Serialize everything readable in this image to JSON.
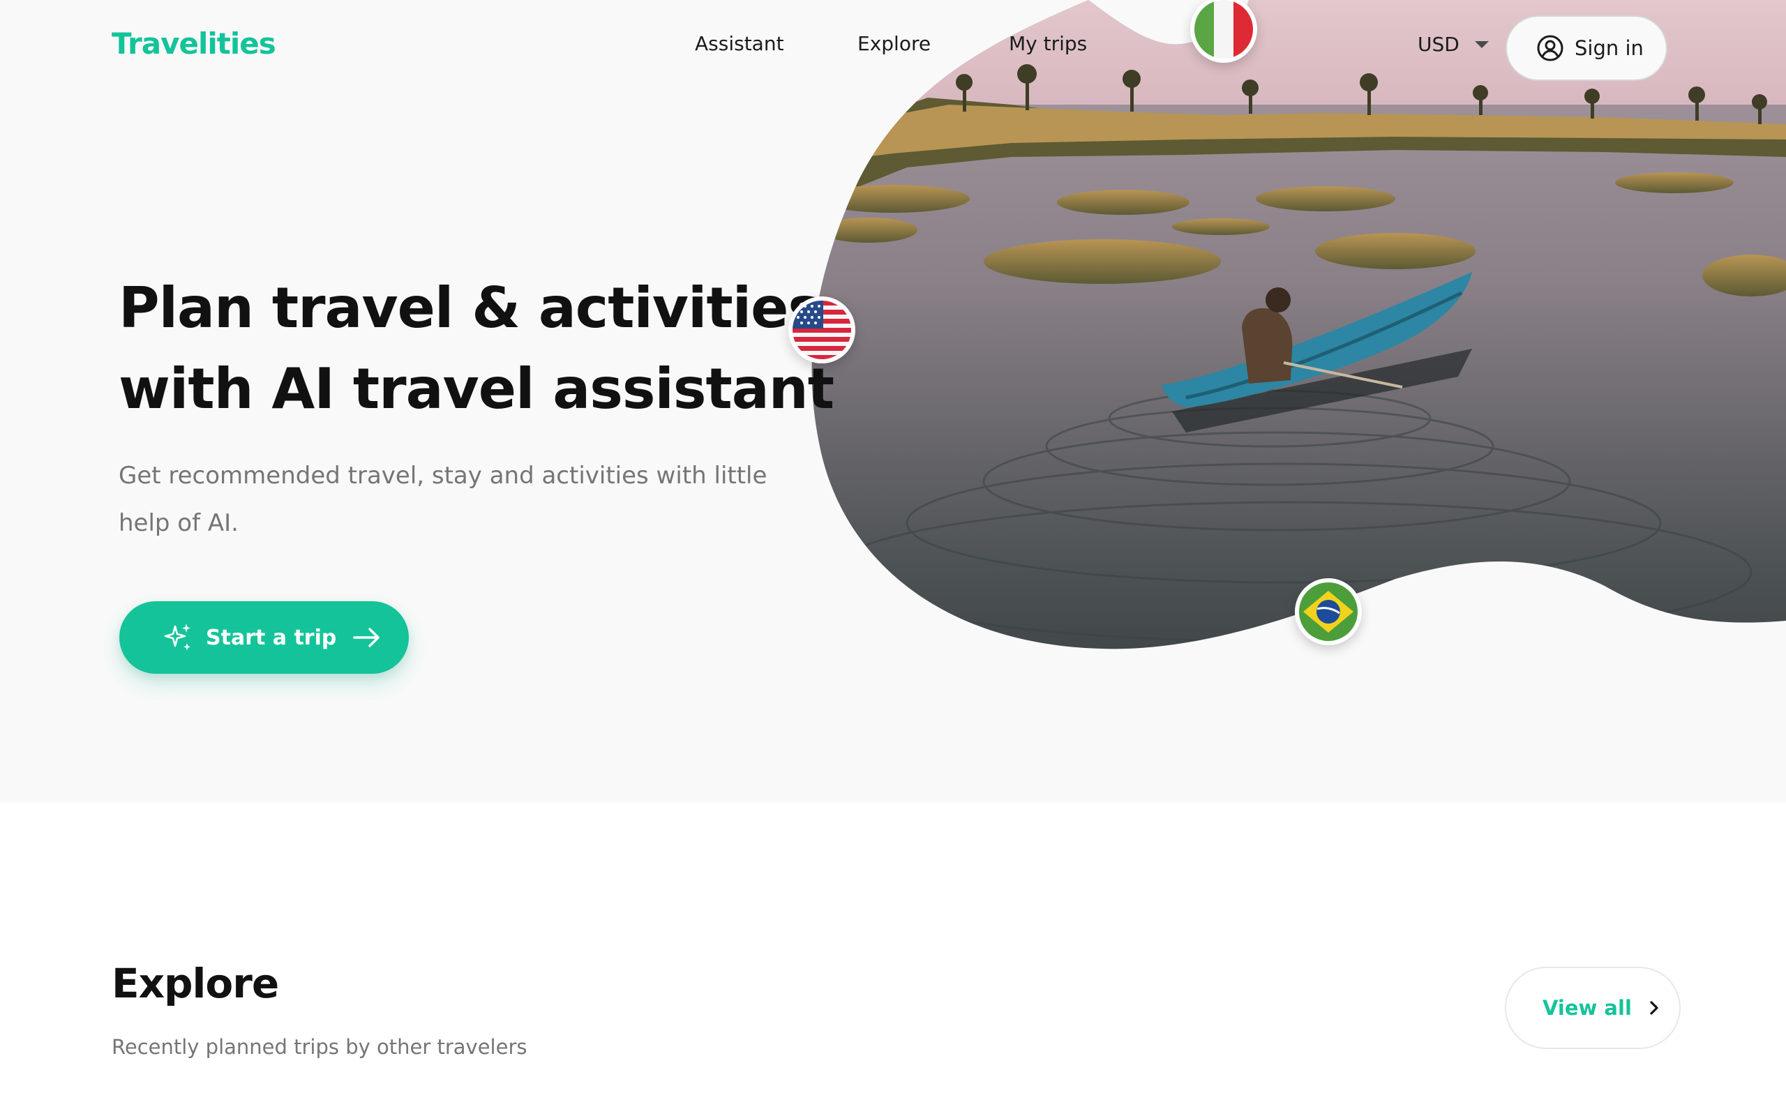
{
  "brand": {
    "name": "Travelities",
    "accent": "#14c39a"
  },
  "nav": {
    "links": [
      "Assistant",
      "Explore",
      "My trips"
    ],
    "currency": "USD",
    "sign_in": "Sign in"
  },
  "hero": {
    "headline_line1": "Plan travel & activities",
    "headline_line2": "with AI travel assistant",
    "subtext": "Get recommended travel, stay and activities with little help of AI.",
    "cta_label": "Start a trip",
    "image": "man paddling a blue canoe on a calm lake with grassy islands",
    "flags": [
      "italy-flag-icon",
      "usa-flag-icon",
      "brazil-flag-icon"
    ]
  },
  "explore": {
    "title": "Explore",
    "subtitle": "Recently planned trips by other travelers",
    "view_all": "View all"
  }
}
